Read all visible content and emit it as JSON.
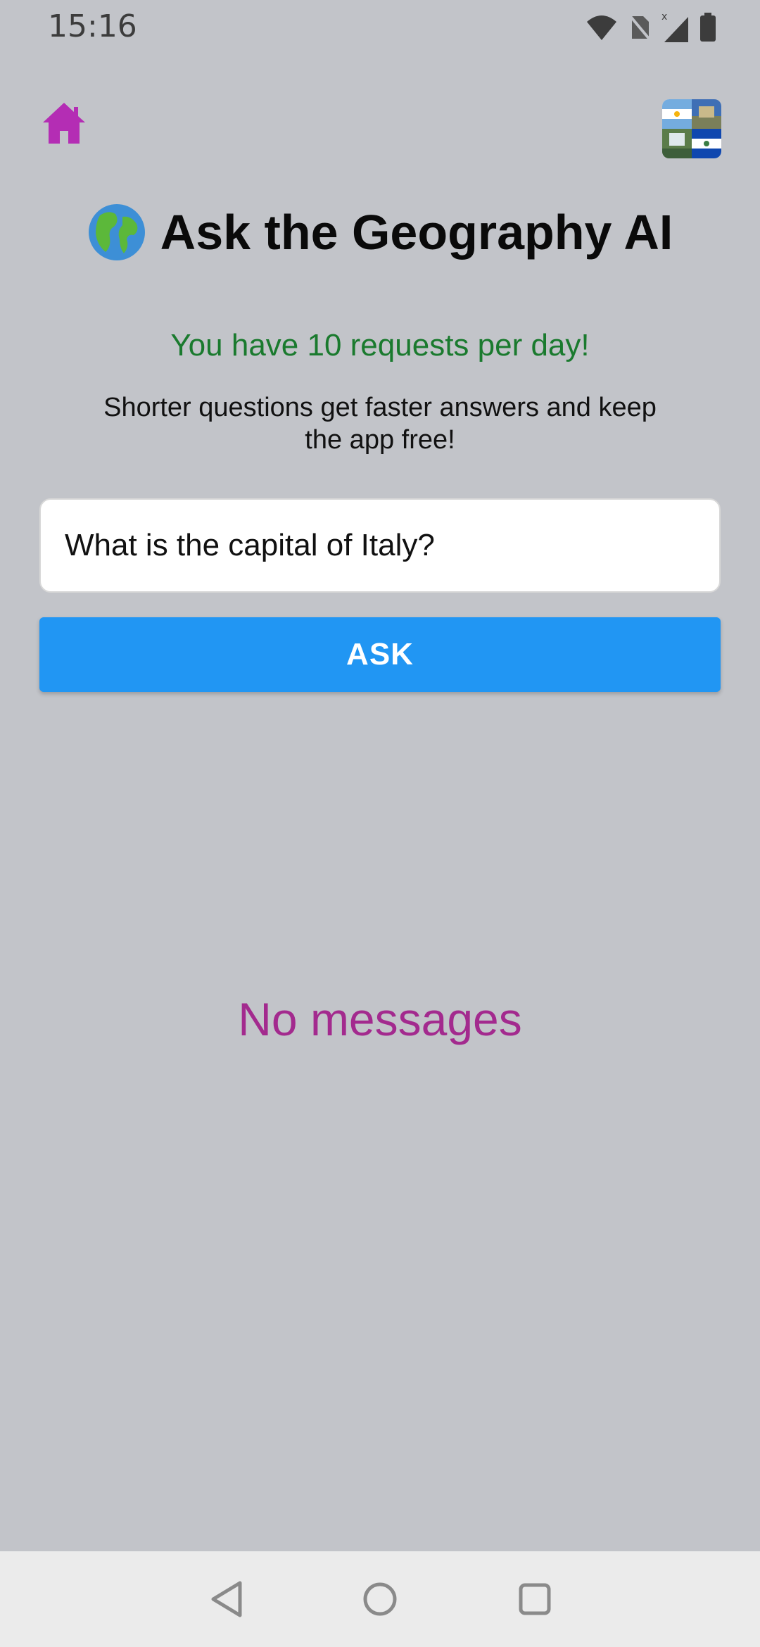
{
  "status_bar": {
    "time": "15:16",
    "icons": [
      "wifi-icon",
      "no-sim-icon",
      "signal-icon",
      "battery-icon"
    ]
  },
  "header": {
    "home_icon": "home-icon",
    "thumbnail": "flags-collage"
  },
  "title": {
    "emoji": "🌍",
    "text": "Ask the Geography AI"
  },
  "info": {
    "requests_text": "You have 10 requests per day!",
    "tip_text": "Shorter questions get faster answers and keep the app free!"
  },
  "question": {
    "value": "What is the capital of Italy?"
  },
  "ask_button": {
    "label": "ASK"
  },
  "messages": {
    "empty_text": "No messages"
  },
  "nav_bar": {
    "buttons": [
      "back-icon",
      "home-circle-icon",
      "recents-icon"
    ]
  },
  "colors": {
    "background": "#c2c4c9",
    "accent_purple": "#b42db4",
    "requests_green": "#1a7a2e",
    "button_blue": "#2196f3",
    "empty_magenta": "#a32a8e"
  }
}
